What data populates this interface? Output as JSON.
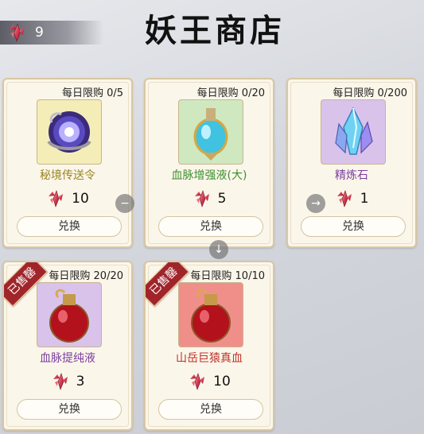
{
  "header": {
    "currency_value": "9",
    "title": "妖王商店"
  },
  "cards": [
    {
      "limit": "每日限购 0/5",
      "name": "秘境传送令",
      "name_color": "#9a8520",
      "price": "10",
      "button": "兑换",
      "item_icon": "portal-orb-icon",
      "thumb_bg": "#f4edb8"
    },
    {
      "limit": "每日限购 0/20",
      "name": "血脉增强液(大)",
      "name_color": "#3c8f2e",
      "price": "5",
      "button": "兑换",
      "item_icon": "blue-potion-icon",
      "thumb_bg": "#cfe8c0"
    },
    {
      "limit": "每日限购 0/200",
      "name": "精炼石",
      "name_color": "#7a3ea0",
      "price": "1",
      "button": "兑换",
      "item_icon": "crystal-icon",
      "thumb_bg": "#d9c3ea"
    },
    {
      "limit": "每日限购 20/20",
      "name": "血脉提纯液",
      "name_color": "#7a3ea0",
      "price": "3",
      "button": "兑换",
      "item_icon": "red-potion-icon",
      "thumb_bg": "#d9c3ea",
      "badge": "已售罄"
    },
    {
      "limit": "每日限购 10/10",
      "name": "山岳巨猿真血",
      "name_color": "#c0312a",
      "price": "10",
      "button": "兑换",
      "item_icon": "red-potion-icon",
      "thumb_bg": "#f08f8a",
      "badge": "已售罄"
    }
  ],
  "nav_icons": [
    "minus-icon",
    "arrow-down-icon",
    "arrow-right-icon"
  ]
}
